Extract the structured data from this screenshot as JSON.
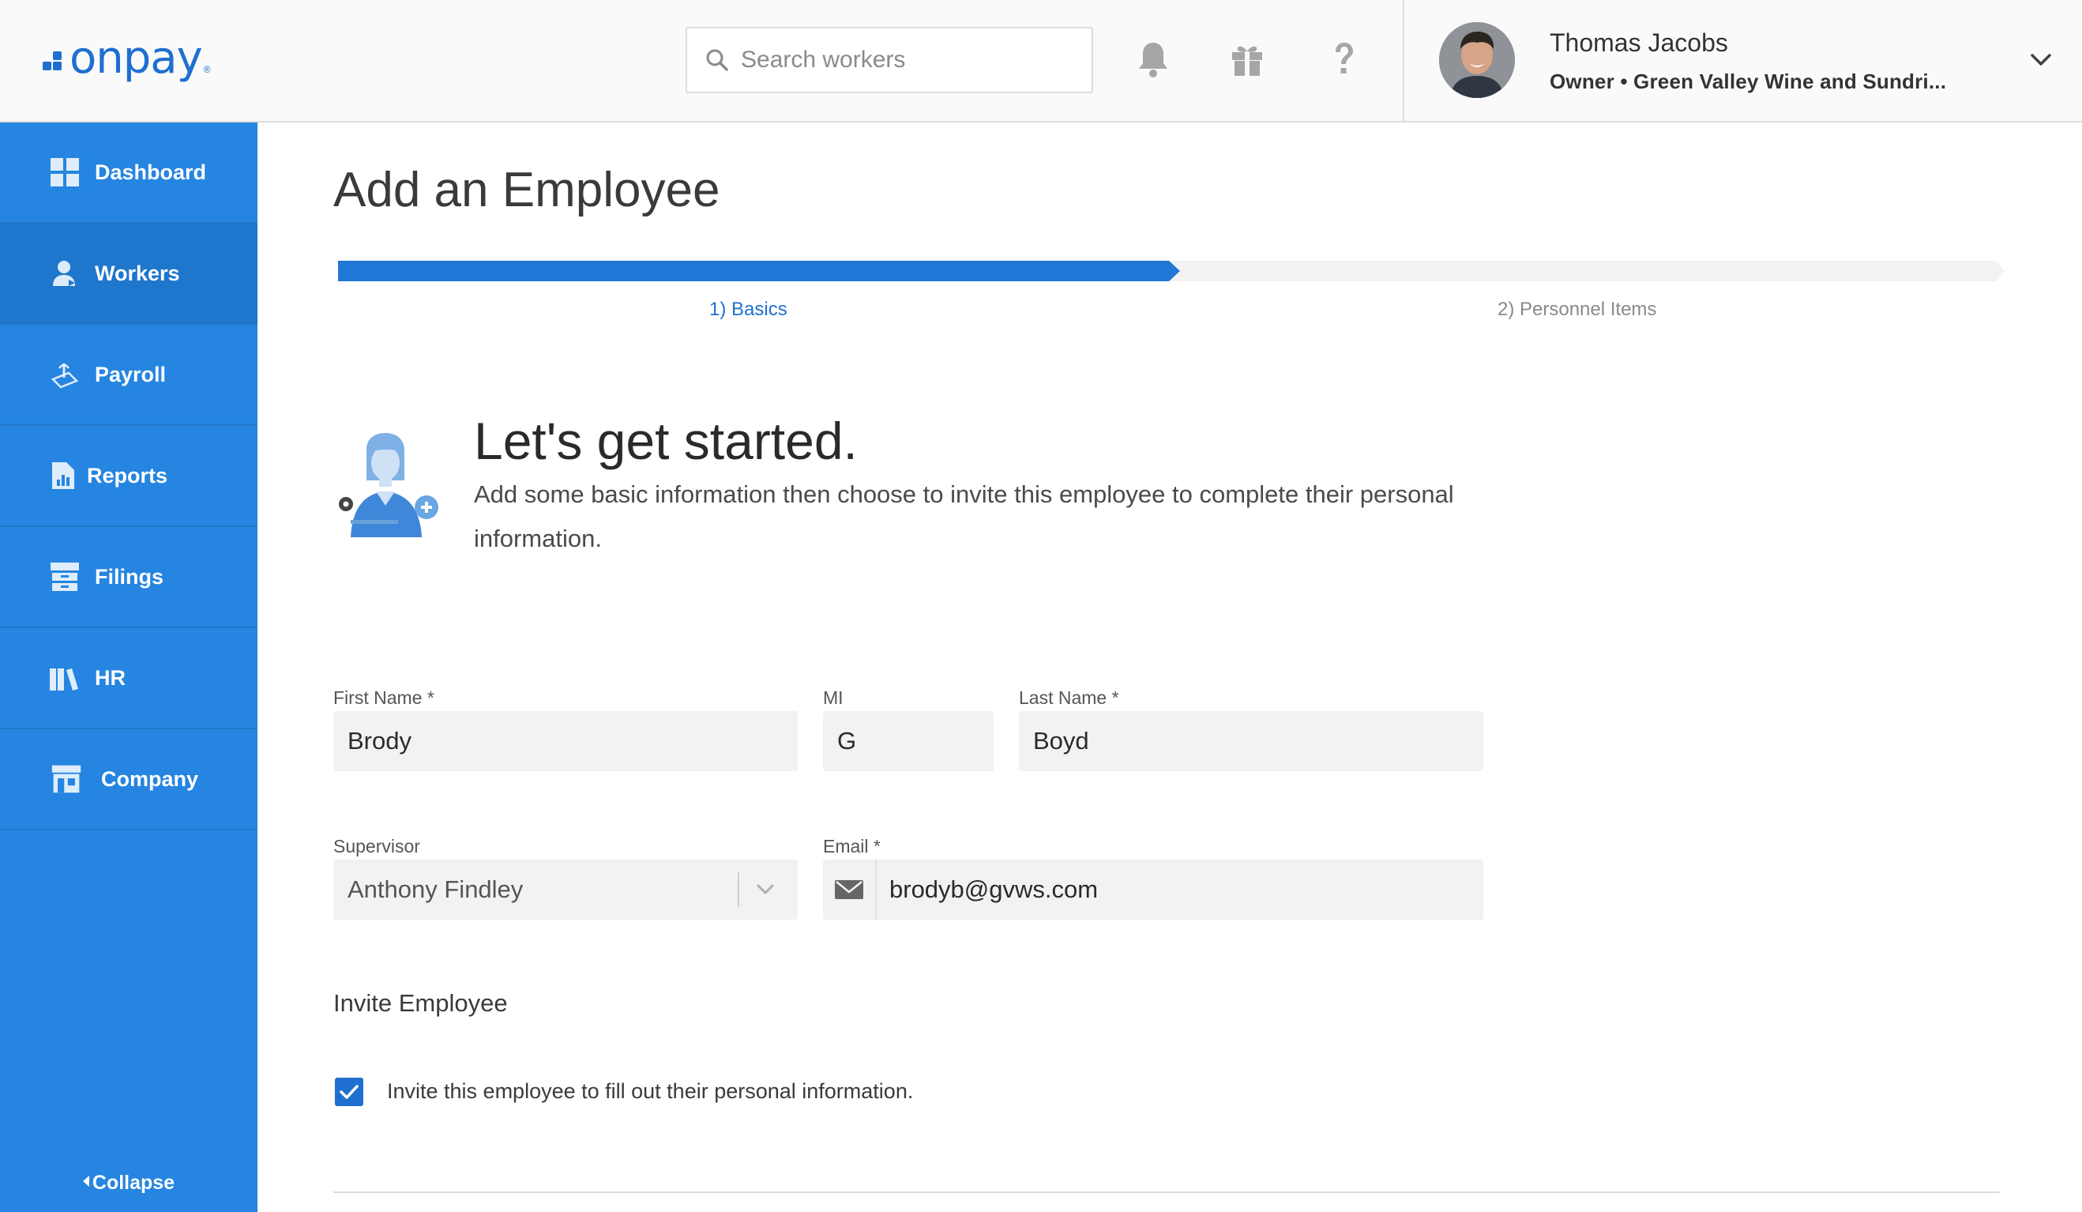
{
  "header": {
    "logo_text": "onpay",
    "logo_mark": "®",
    "search_placeholder": "Search workers",
    "icons": [
      "bell-icon",
      "gift-icon",
      "help-icon"
    ],
    "user": {
      "name": "Thomas Jacobs",
      "role": "Owner • Green Valley Wine and Sundri..."
    }
  },
  "sidebar": {
    "items": [
      {
        "label": "Dashboard",
        "icon": "dashboard-icon",
        "active": false
      },
      {
        "label": "Workers",
        "icon": "workers-icon",
        "active": true
      },
      {
        "label": "Payroll",
        "icon": "payroll-icon",
        "active": false
      },
      {
        "label": "Reports",
        "icon": "reports-icon",
        "active": false
      },
      {
        "label": "Filings",
        "icon": "filings-icon",
        "active": false
      },
      {
        "label": "HR",
        "icon": "hr-icon",
        "active": false
      },
      {
        "label": "Company",
        "icon": "company-icon",
        "active": false
      }
    ],
    "collapse_label": "Collapse"
  },
  "main": {
    "title": "Add an Employee",
    "progress": {
      "current_step": 1,
      "total_steps": 2,
      "steps": [
        {
          "label": "1) Basics"
        },
        {
          "label": "2) Personnel Items"
        }
      ]
    },
    "intro": {
      "heading": "Let's get started.",
      "text": "Add some basic information then choose to invite this employee to complete their personal information."
    },
    "form": {
      "first_name": {
        "label": "First Name *",
        "value": "Brody"
      },
      "mi": {
        "label": "MI",
        "value": "G"
      },
      "last_name": {
        "label": "Last Name *",
        "value": "Boyd"
      },
      "supervisor": {
        "label": "Supervisor",
        "value": "Anthony Findley"
      },
      "email": {
        "label": "Email *",
        "value": "brodyb@gvws.com"
      }
    },
    "invite": {
      "title": "Invite Employee",
      "checkbox_label": "Invite this employee to fill out their personal information.",
      "checked": true
    }
  },
  "colors": {
    "brand": "#1f6fd0",
    "sidebar": "#2585e0",
    "sidebar_active": "#1f76cd",
    "field_bg": "#f2f2f2"
  }
}
